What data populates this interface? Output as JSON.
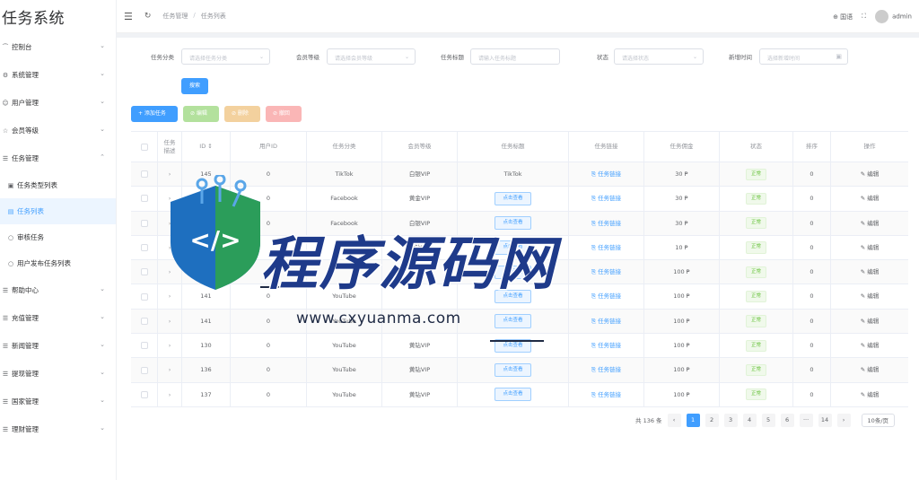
{
  "app": {
    "title": "任务系统"
  },
  "sidebar": {
    "items": [
      {
        "icon": "⁀",
        "label": "控制台"
      },
      {
        "icon": "⚙",
        "label": "系统管理"
      },
      {
        "icon": "☺",
        "label": "用户管理"
      },
      {
        "icon": "☆",
        "label": "会员等级"
      },
      {
        "icon": "☰",
        "label": "任务管理"
      }
    ],
    "sub_items": [
      {
        "icon": "▣",
        "label": "任务类型列表"
      },
      {
        "icon": "▤",
        "label": "任务列表"
      },
      {
        "icon": "○",
        "label": "审核任务"
      },
      {
        "icon": "○",
        "label": "用户发布任务列表"
      }
    ],
    "items2": [
      {
        "icon": "☰",
        "label": "帮助中心"
      },
      {
        "icon": "☰",
        "label": "充值管理"
      },
      {
        "icon": "☰",
        "label": "新闻管理"
      },
      {
        "icon": "☰",
        "label": "提现管理"
      },
      {
        "icon": "☰",
        "label": "国家管理"
      },
      {
        "icon": "☰",
        "label": "理财管理"
      }
    ]
  },
  "header": {
    "breadcrumb": [
      "任务管理",
      "任务列表"
    ],
    "lang_label": "⊕ 国语",
    "fullscreen_icon": "⛶",
    "user": "admin"
  },
  "filters": {
    "type_label": "任务分类",
    "type_placeholder": "请选择任务分类",
    "level_label": "会员等级",
    "level_placeholder": "请选择会员等级",
    "title_label": "任务标题",
    "title_placeholder": "请输入任务标题",
    "status_label": "状态",
    "status_placeholder": "请选择状态",
    "time_label": "新增时间",
    "time_placeholder": "选择新增时间",
    "search_label": "搜索"
  },
  "actions": {
    "add": "+ 添加任务",
    "edit": "⊘ 编辑",
    "delete": "⊘ 删除",
    "audit": "⊘ 撤回"
  },
  "table": {
    "columns": [
      "",
      "任务\n描述",
      "ID ↕",
      "用户ID",
      "任务分类",
      "会员等级",
      "任务标题",
      "任务链接",
      "任务佣金",
      "状态",
      "排序",
      "操作"
    ],
    "rows": [
      {
        "id": "145",
        "uid": "0",
        "category": "TikTok",
        "level": "白银VIP",
        "title": "TikTok",
        "title_is_btn": false,
        "link": "⎘ 任务链接",
        "reward": "30 ₱",
        "status": "正常",
        "sort": "0",
        "op": "✎ 编辑"
      },
      {
        "id": "144",
        "uid": "0",
        "category": "Facebook",
        "level": "黄金VIP",
        "title": "点击查看",
        "title_is_btn": true,
        "link": "⎘ 任务链接",
        "reward": "30 ₱",
        "status": "正常",
        "sort": "0",
        "op": "✎ 编辑"
      },
      {
        "id": "",
        "uid": "0",
        "category": "Facebook",
        "level": "白银VIP",
        "title": "点击查看",
        "title_is_btn": true,
        "link": "⎘ 任务链接",
        "reward": "30 ₱",
        "status": "正常",
        "sort": "0",
        "op": "✎ 编辑"
      },
      {
        "id": "",
        "uid": "",
        "category": "",
        "level": "黄钻VIP",
        "title": "点击查看",
        "title_is_btn": true,
        "link": "⎘ 任务链接",
        "reward": "10 ₱",
        "status": "正常",
        "sort": "0",
        "op": "✎ 编辑"
      },
      {
        "id": "",
        "uid": "",
        "category": "",
        "level": "",
        "title": "点击查看",
        "title_is_btn": true,
        "link": "⎘ 任务链接",
        "reward": "100 ₱",
        "status": "正常",
        "sort": "0",
        "op": "✎ 编辑"
      },
      {
        "id": "141",
        "uid": "0",
        "category": "YouTube",
        "level": "",
        "title": "点击查看",
        "title_is_btn": true,
        "link": "⎘ 任务链接",
        "reward": "100 ₱",
        "status": "正常",
        "sort": "0",
        "op": "✎ 编辑"
      },
      {
        "id": "141",
        "uid": "0",
        "category": "YouTube",
        "level": "",
        "title": "点击查看",
        "title_is_btn": true,
        "link": "⎘ 任务链接",
        "reward": "100 ₱",
        "status": "正常",
        "sort": "0",
        "op": "✎ 编辑"
      },
      {
        "id": "130",
        "uid": "0",
        "category": "YouTube",
        "level": "黄钻VIP",
        "title": "点击查看",
        "title_is_btn": true,
        "link": "⎘ 任务链接",
        "reward": "100 ₱",
        "status": "正常",
        "sort": "0",
        "op": "✎ 编辑"
      },
      {
        "id": "136",
        "uid": "0",
        "category": "YouTube",
        "level": "黄钻VIP",
        "title": "点击查看",
        "title_is_btn": true,
        "link": "⎘ 任务链接",
        "reward": "100 ₱",
        "status": "正常",
        "sort": "0",
        "op": "✎ 编辑"
      },
      {
        "id": "137",
        "uid": "0",
        "category": "YouTube",
        "level": "黄钻VIP",
        "title": "点击查看",
        "title_is_btn": true,
        "link": "⎘ 任务链接",
        "reward": "100 ₱",
        "status": "正常",
        "sort": "0",
        "op": "✎ 编辑"
      }
    ]
  },
  "pager": {
    "total": "共 136 条",
    "prev": "‹",
    "pages": [
      "1",
      "2",
      "3",
      "4",
      "5",
      "6",
      "···",
      "14"
    ],
    "next": "›",
    "size": "10条/页"
  },
  "watermark": {
    "title": "程序源码网",
    "url": "www.cxyuanma.com",
    "logo_text": "</>"
  },
  "colors": {
    "primary": "#409eff",
    "success": "#67c23a"
  }
}
